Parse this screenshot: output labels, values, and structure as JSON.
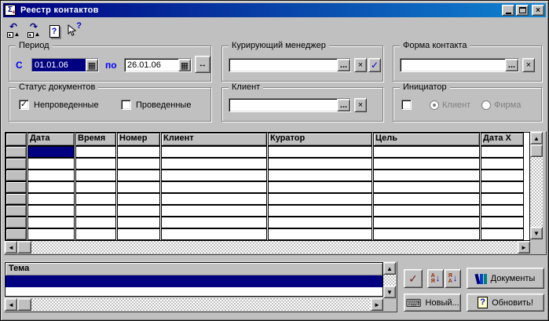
{
  "window": {
    "title": "Реестр контактов"
  },
  "colors": {
    "titlebar_from": "#000080",
    "titlebar_to": "#1084d0",
    "selection": "#000080",
    "face": "#c0c0c0",
    "label_blue": "#0000ff"
  },
  "titlebar": {
    "close_glyph": "×"
  },
  "toolbar": {
    "buttons": [
      {
        "name": "prev-interval",
        "glyph": "↶",
        "tri": "▲"
      },
      {
        "name": "next-interval",
        "glyph": "↷",
        "tri": "▲"
      },
      {
        "name": "help",
        "glyph": "?"
      },
      {
        "name": "context-help",
        "glyph": "?"
      }
    ]
  },
  "filters": {
    "period": {
      "caption": "Период",
      "from_label": "С",
      "from_value": "01.01.06",
      "to_label": "по",
      "to_value": "26.01.06",
      "calendar_glyph": "▦",
      "range_glyph": "↔"
    },
    "status": {
      "caption": "Статус документов",
      "options": [
        {
          "label": "Непроведенные",
          "checked": true,
          "glyph": "✓"
        },
        {
          "label": "Проведенные",
          "checked": false,
          "glyph": ""
        }
      ]
    },
    "manager": {
      "caption": "Курирующий менеджер",
      "value": "",
      "browse": "...",
      "clear": "×",
      "apply": "✓"
    },
    "client": {
      "caption": "Клиент",
      "value": "",
      "browse": "...",
      "clear": "×"
    },
    "contact_form": {
      "caption": "Форма контакта",
      "value": "",
      "browse": "...",
      "clear": "×"
    },
    "initiator": {
      "caption": "Инициатор",
      "enabled_checked": false,
      "enabled_glyph": "",
      "options": [
        {
          "label": "Клиент",
          "selected": true
        },
        {
          "label": "Фирма",
          "selected": false
        }
      ]
    }
  },
  "table": {
    "columns": [
      "Дата",
      "Время",
      "Номер",
      "Клиент",
      "Куратор",
      "Цель",
      "Дата Х"
    ],
    "visible_rows": 8,
    "selected": {
      "row": 0,
      "column": "Дата"
    },
    "rows": []
  },
  "theme": {
    "header": "Тема",
    "selected_row": ""
  },
  "actions": {
    "confirm_glyph": "✓",
    "sort_asc": {
      "top": "А",
      "bottom": "Я",
      "arrow": "↓"
    },
    "sort_desc": {
      "top": "Я",
      "bottom": "А",
      "arrow": "↓"
    },
    "documents": "Документы",
    "new": "Новый...",
    "refresh": "Обновить!",
    "new_glyph": "⌨",
    "refresh_glyph": "?"
  },
  "scroll_glyphs": {
    "up": "▲",
    "down": "▼",
    "left": "◄",
    "right": "►"
  }
}
